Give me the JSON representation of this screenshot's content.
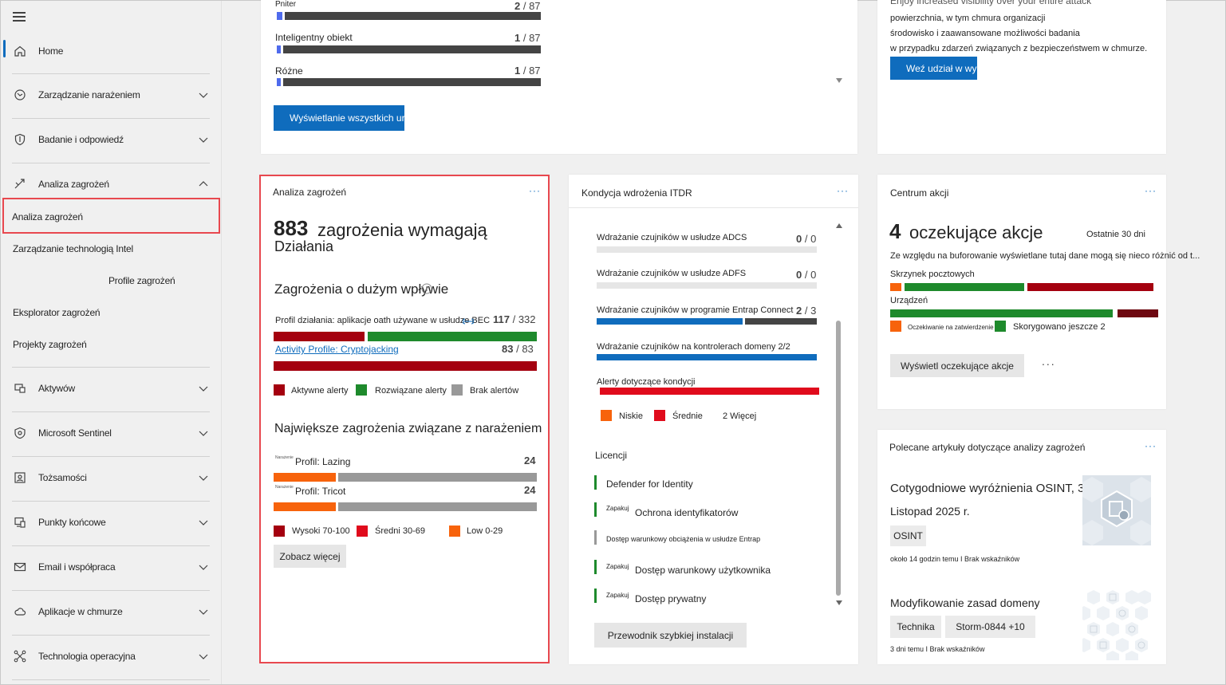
{
  "sidebar": {
    "items": [
      {
        "label": "Home",
        "icon": "home-icon"
      },
      {
        "label": "Zarządzanie narażeniem",
        "icon": "exposure-icon"
      },
      {
        "label": "Badanie i odpowiedź",
        "icon": "shield-icon"
      },
      {
        "label": "Analiza zagrożeń",
        "icon": "threat-intel-icon"
      },
      {
        "label": "Aktywów",
        "icon": "assets-icon"
      },
      {
        "label": "Microsoft Sentinel",
        "icon": "sentinel-icon"
      },
      {
        "label": "Tożsamości",
        "icon": "identity-icon"
      },
      {
        "label": "Punkty końcowe",
        "icon": "endpoints-icon"
      },
      {
        "label": "Email i współpraca",
        "icon": "email-icon"
      },
      {
        "label": "Aplikacje w chmurze",
        "icon": "cloud-icon"
      },
      {
        "label": "Technologia operacyjna",
        "icon": "ot-icon"
      }
    ],
    "subitems": [
      "Analiza zagrożeń",
      "Zarządzanie technologią Intel",
      "Profile zagrożeń",
      "Eksplorator zagrożeń",
      "Projekty zagrożeń"
    ]
  },
  "top_left_card": {
    "rows": [
      {
        "label": "Pniter",
        "count": "2",
        "total": "87"
      },
      {
        "label": "Inteligentny obiekt",
        "count": "1",
        "total": "87"
      },
      {
        "label": "Różne",
        "count": "1",
        "total": "87"
      }
    ],
    "button": "Wyświetlanie wszystkich ur"
  },
  "top_right_card": {
    "line0": "Enjoy increased visibility over your entire attack",
    "line1": "powierzchnia, w tym chmura organizacji",
    "line2": "środowisko i zaawansowane możliwości badania",
    "line3": "w przypadku zdarzeń związanych z bezpieczeństwem w chmurze.",
    "button": "Weź udział w wyd"
  },
  "threat_card": {
    "title": "Analiza zagrożeń",
    "big_number": "883",
    "headline": "zagrożenia wymagają",
    "headline2": "Działania",
    "section1": "Zagrożenia o dużym wpływie",
    "profile1_label": "Profil działania: aplikacje oath używane w usłudze BEC",
    "profile1_count": "117",
    "profile1_total": "332",
    "profile2_label": "Activity Profile: Cryptojacking",
    "profile2_count": "83",
    "profile2_total": "83",
    "legend1": [
      "Aktywne alerty",
      "Rozwiązane alerty",
      "Brak alertów"
    ],
    "section2": "Największe zagrożenia związane z narażeniem",
    "small_prefix": "Narażenie",
    "exp1_label": "Profil: Lazing",
    "exp1_value": "24",
    "exp2_label": "Profil: Tricot",
    "exp2_value": "24",
    "legend2": [
      "Wysoki 70-100",
      "Średni 30-69",
      "Low 0-29"
    ],
    "button": "Zobacz więcej"
  },
  "itdr_card": {
    "title": "Kondycja wdrożenia ITDR",
    "rows": [
      {
        "label": "Wdrażanie czujników w usłudze ADCS",
        "count": "0",
        "total": "0"
      },
      {
        "label": "Wdrażanie czujników w usłudze ADFS",
        "count": "0",
        "total": "0"
      },
      {
        "label": "Wdrażanie czujników w programie Entrap Connect",
        "count": "2",
        "total": "3"
      },
      {
        "label": "Wdrażanie czujników na kontrolerach domeny 2/2"
      },
      {
        "label": "Alerty dotyczące kondycji"
      }
    ],
    "legend": [
      "Niskie",
      "Średnie",
      "2 Więcej"
    ],
    "licenses_title": "Licencji",
    "licenses": [
      {
        "prefix": "",
        "label": "Defender for Identity"
      },
      {
        "prefix": "Zapakuj",
        "label": "Ochrona identyfikatorów"
      },
      {
        "prefix": "",
        "label": "Dostęp warunkowy obciążenia w usłudze Entrap"
      },
      {
        "prefix": "Zapakuj",
        "label": "Dostęp warunkowy użytkownika"
      },
      {
        "prefix": "Zapakuj",
        "label": "Dostęp prywatny"
      }
    ],
    "button": "Przewodnik szybkiej instalacji"
  },
  "action_card": {
    "title": "Centrum akcji",
    "big_number": "4",
    "headline": "oczekujące akcje",
    "period": "Ostatnie 30 dni",
    "note": "Ze względu na buforowanie wyświetlane tutaj dane mogą się nieco różnić od t...",
    "row1": "Skrzynek pocztowych",
    "row2": "Urządzeń",
    "legend1": "Oczekiwanie na zatwierdzenie",
    "legend2": "Skorygowano jeszcze 2",
    "button": "Wyświetl oczekujące akcje",
    "ellipsis": "..."
  },
  "articles_card": {
    "title": "Polecane artykuły dotyczące analizy zagrożeń",
    "a1_line1": "Cotygodniowe wyróżnienia OSINT, 3",
    "a1_line2": "Listopad 2025 r.",
    "a1_tag": "OSINT",
    "a1_meta": "około 14 godzin temu I Brak wskaźników",
    "a2_title": "Modyfikowanie zasad domeny",
    "a2_tags": [
      "Technika",
      "Storm-0844 +10"
    ],
    "a2_meta": "3 dni temu I Brak wskaźników"
  },
  "colors": {
    "accent": "#0f6cbd",
    "dark_red": "#a4000f",
    "green": "#1e8a2c",
    "gray": "#999999",
    "orange": "#f7630c",
    "red": "#e00b1c"
  }
}
